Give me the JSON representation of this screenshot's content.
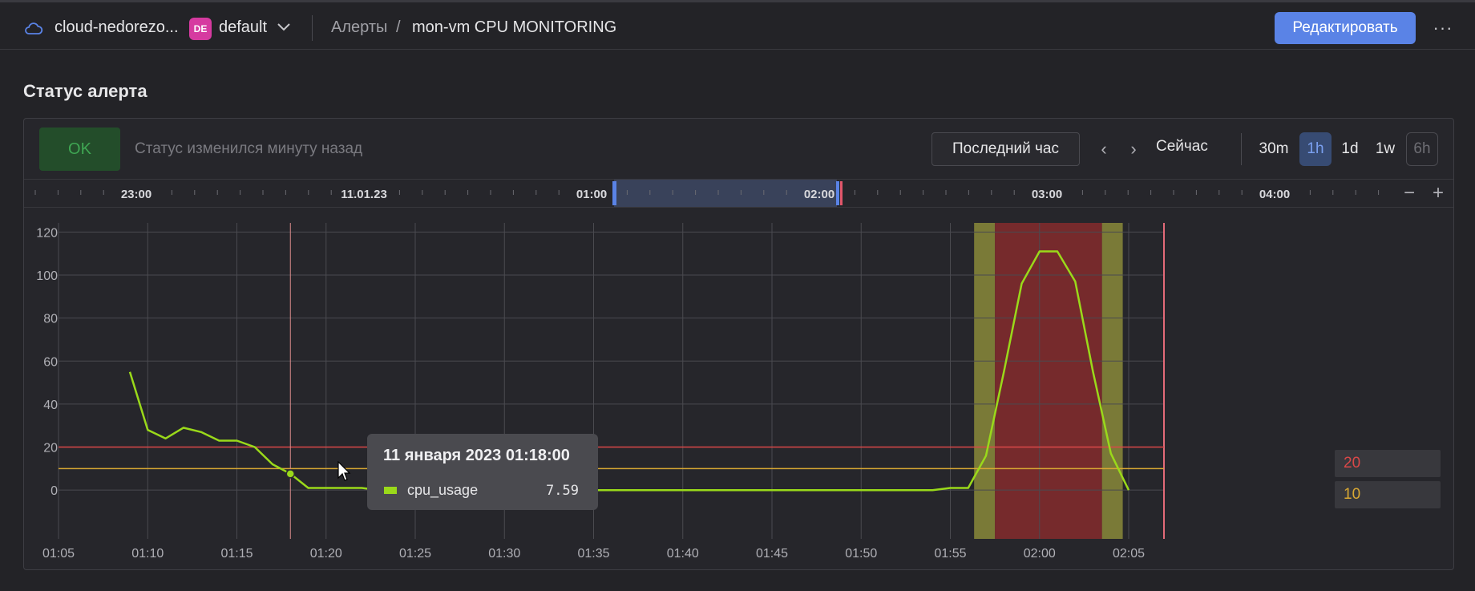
{
  "header": {
    "cloud_name": "cloud-nedorezo...",
    "folder_badge": "DE",
    "folder_name": "default",
    "breadcrumb_alerts": "Алерты",
    "breadcrumb_sep": "/",
    "breadcrumb_current": "mon-vm CPU MONITORING",
    "edit_label": "Редактировать",
    "more_label": "···"
  },
  "section_title": "Статус алерта",
  "status": {
    "badge": "OK",
    "text": "Статус изменился минуту назад"
  },
  "toolbar": {
    "range_label": "Последний час",
    "prev": "‹",
    "next": "›",
    "now_label": "Сейчас",
    "scales": [
      "30m",
      "1h",
      "1d",
      "1w",
      "6h"
    ],
    "selected_scale": "1h",
    "zoom_out": "−",
    "zoom_in": "+"
  },
  "timeline": {
    "labels": [
      {
        "text": "23:00"
      },
      {
        "text": "11.01.23"
      },
      {
        "text": "01:00"
      },
      {
        "text": "02:00"
      },
      {
        "text": "03:00"
      },
      {
        "text": "04:00"
      }
    ],
    "selection_from": "01:05",
    "selection_to": "02:05"
  },
  "thresholds": {
    "alarm": "20",
    "warn": "10"
  },
  "tooltip": {
    "title": "11 января 2023 01:18:00",
    "series": "cpu_usage",
    "value": "7.59"
  },
  "colors": {
    "line": "#9ad91a",
    "alarm": "#d94848",
    "warn": "#d9a833",
    "accent": "#5a83e6",
    "ok": "#3fa653"
  },
  "chart_data": {
    "type": "line",
    "series": [
      {
        "name": "cpu_usage",
        "x": [
          "01:09",
          "01:10",
          "01:11",
          "01:12",
          "01:13",
          "01:14",
          "01:15",
          "01:16",
          "01:17",
          "01:18",
          "01:19",
          "01:20",
          "01:21",
          "01:22",
          "01:23",
          "01:30",
          "01:40",
          "01:50",
          "01:54",
          "01:55",
          "01:56",
          "01:57",
          "01:58",
          "01:59",
          "02:00",
          "02:01",
          "02:02",
          "02:03",
          "02:04",
          "02:05"
        ],
        "values": [
          55,
          28,
          24,
          29,
          27,
          23,
          23,
          20,
          12,
          7.59,
          1,
          1,
          1,
          1,
          0,
          0,
          0,
          0,
          0,
          1,
          1,
          16,
          55,
          96,
          111,
          111,
          97,
          55,
          17,
          0
        ]
      }
    ],
    "xticks": [
      "01:05",
      "01:10",
      "01:15",
      "01:20",
      "01:25",
      "01:30",
      "01:35",
      "01:40",
      "01:45",
      "01:50",
      "01:55",
      "02:00",
      "02:05"
    ],
    "yticks": [
      0,
      20,
      40,
      60,
      80,
      100,
      120
    ],
    "ylim": [
      -10,
      122
    ],
    "xlim": [
      "01:05",
      "02:05"
    ],
    "threshold_alarm": 20,
    "threshold_warn": 10,
    "alarm_zone": [
      "01:57:30",
      "02:03:30"
    ],
    "warn_zones": [
      [
        "01:56:20",
        "01:57:30"
      ],
      [
        "02:03:30",
        "02:04:40"
      ]
    ],
    "cursor": "01:18",
    "grid": true
  }
}
